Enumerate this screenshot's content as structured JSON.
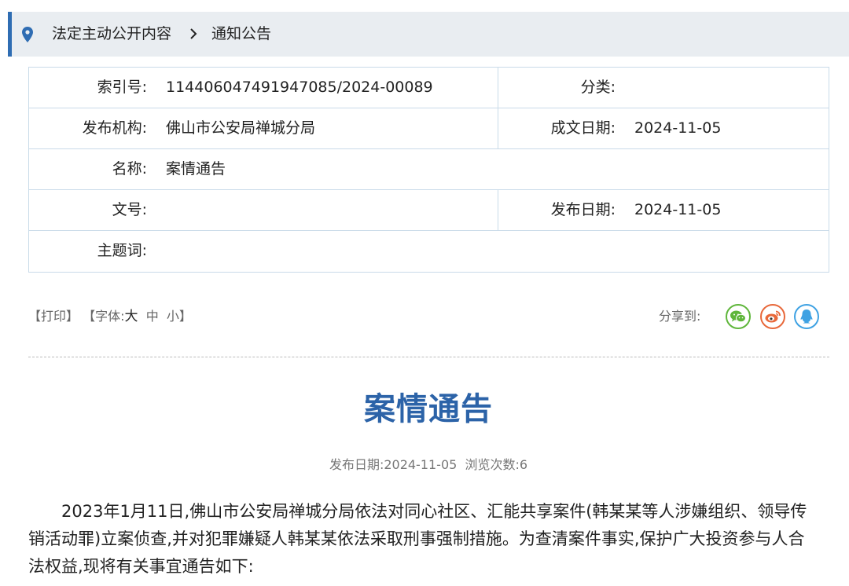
{
  "breadcrumb": {
    "items": [
      "法定主动公开内容",
      "通知公告"
    ],
    "separator": ">"
  },
  "meta": {
    "index_label": "索引号:",
    "index_value": "11440604749194708​5/2024-00089",
    "category_label": "分类:",
    "category_value": "",
    "publisher_label": "发布机构:",
    "publisher_value": "佛山市公安局禅城分局",
    "written_date_label": "成文日期:",
    "written_date_value": "2024-11-05",
    "name_label": "名称:",
    "name_value": "案情通告",
    "doc_no_label": "文号:",
    "doc_no_value": "",
    "publish_date_label": "发布日期:",
    "publish_date_value": "2024-11-05",
    "keywords_label": "主题词:",
    "keywords_value": ""
  },
  "toolbar": {
    "print": "【打印】",
    "font_prefix": "【字体:",
    "font_big": "大",
    "font_mid": "中",
    "font_small": "小",
    "font_suffix": "】",
    "share_label": "分享到:"
  },
  "share": [
    "wechat-icon",
    "weibo-icon",
    "qq-icon"
  ],
  "colors": {
    "accent": "#2f6db3",
    "title": "#2c63a8",
    "wechat": "#5fb63b",
    "weibo": "#e8683a",
    "qq": "#3fa2e3"
  },
  "article": {
    "title": "案情通告",
    "meta": "发布日期:2024-11-05  浏览次数:6",
    "paragraph": "2023年1月11日,佛山市公安局禅城分局依法对同心社区、汇能共享案件(韩某某等人涉嫌组织、领导传销活动罪)立案侦查,并对犯罪嫌疑人韩某某依法采取刑事强制措施。为查清案件事实,保护广大投资参与人合法权益,现将有关事宜通告如下:"
  }
}
